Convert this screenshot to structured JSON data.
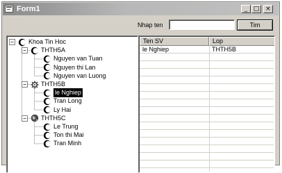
{
  "window": {
    "title": "Form1"
  },
  "search": {
    "label": "Nhap ten",
    "value": "",
    "button": "Tim"
  },
  "tree": [
    {
      "label": "Khoa Tin Hoc",
      "level": 0,
      "expander": "−",
      "icon": "moon-icon"
    },
    {
      "label": "THTH5A",
      "level": 1,
      "expander": "−",
      "icon": "moon-icon"
    },
    {
      "label": "Nguyen van Tuan",
      "level": 2,
      "icon": "moon-icon"
    },
    {
      "label": "Nguyen thi Lan",
      "level": 2,
      "icon": "moon-icon"
    },
    {
      "label": "Nguyen van Luong",
      "level": 2,
      "icon": "moon-icon"
    },
    {
      "label": "THTH5B",
      "level": 1,
      "expander": "−",
      "icon": "gear-icon"
    },
    {
      "label": "le Nghiep",
      "level": 2,
      "icon": "moon-icon",
      "selected": true
    },
    {
      "label": "Tran Long",
      "level": 2,
      "icon": "moon-icon"
    },
    {
      "label": "Ly Hai",
      "level": 2,
      "icon": "moon-icon"
    },
    {
      "label": "THTH5C",
      "level": 1,
      "expander": "−",
      "icon": "globe-icon"
    },
    {
      "label": "Le Trung",
      "level": 2,
      "icon": "moon-icon"
    },
    {
      "label": "Ton thi Mai",
      "level": 2,
      "icon": "moon-icon"
    },
    {
      "label": "Tran Minh",
      "level": 2,
      "icon": "moon-icon"
    }
  ],
  "grid": {
    "columns": [
      "Ten SV",
      "Lop"
    ],
    "rows": [
      [
        "le Nghiep",
        "THTH5B"
      ]
    ]
  }
}
